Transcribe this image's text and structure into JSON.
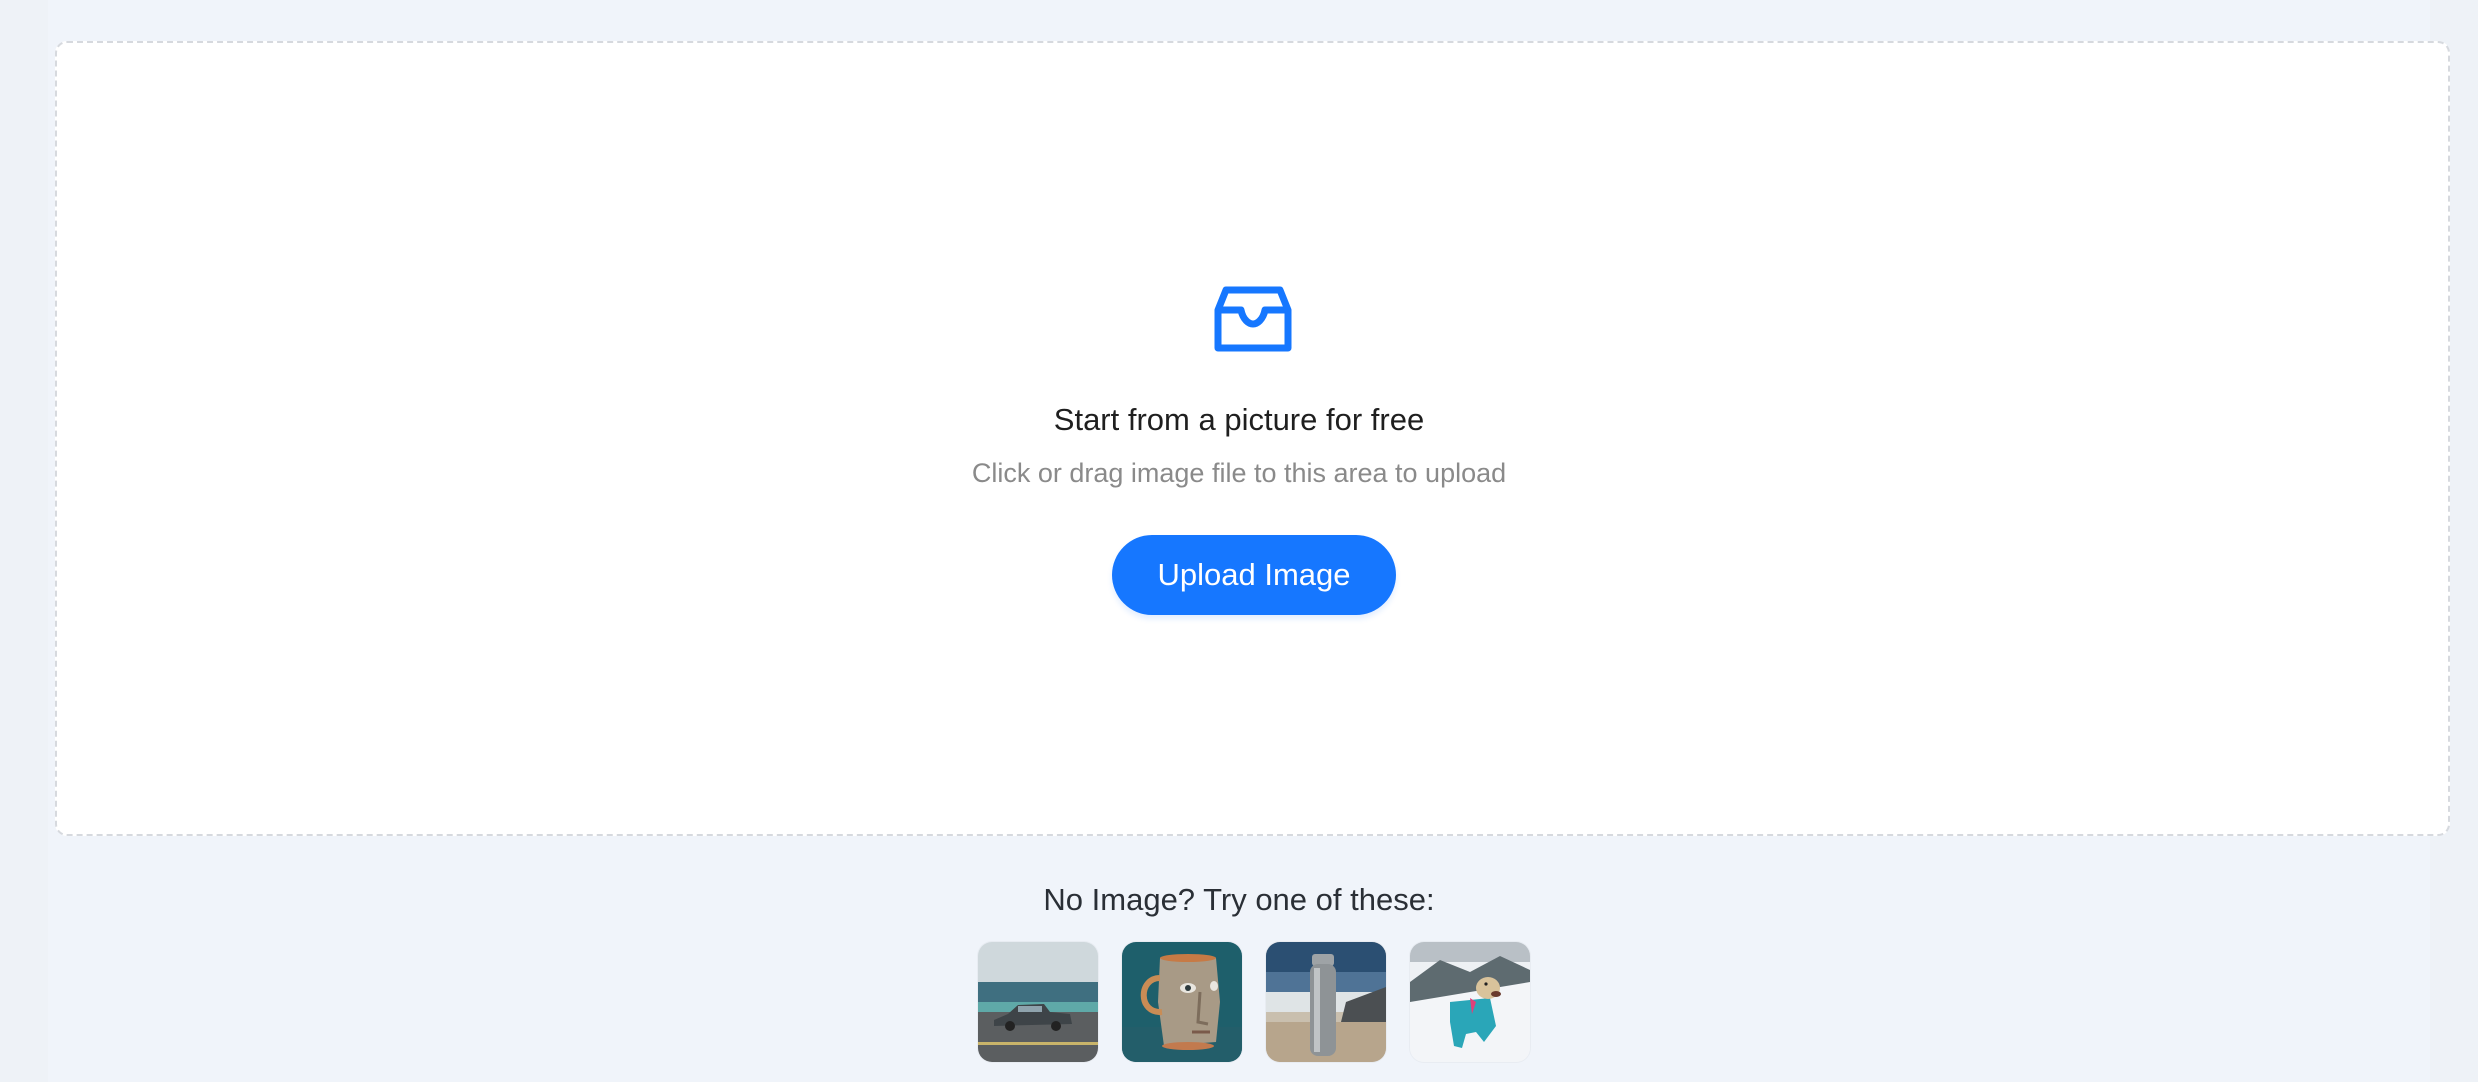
{
  "upload_area": {
    "icon": "inbox-icon",
    "title": "Start from a picture for free",
    "hint": "Click or drag image file to this area to upload",
    "button_label": "Upload Image"
  },
  "samples": {
    "label": "No Image? Try one of these:",
    "items": [
      {
        "subject": "vintage car by the sea",
        "icon": "sample-car-image"
      },
      {
        "subject": "face mug",
        "icon": "sample-mug-image"
      },
      {
        "subject": "steel water bottle on rocks",
        "icon": "sample-bottle-image"
      },
      {
        "subject": "dog in snow jacket",
        "icon": "sample-dog-image"
      }
    ]
  },
  "colors": {
    "accent": "#1677ff",
    "background": "#eef2f7",
    "dropzone_border": "#d6d9de",
    "title_text": "#1f1f1f",
    "hint_text": "#8a8a8a"
  }
}
